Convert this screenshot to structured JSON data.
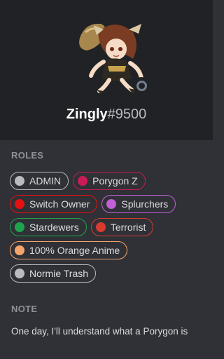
{
  "profile": {
    "username": "Zingly",
    "discriminator": "#9500",
    "status": "offline",
    "status_color": "#747f8d"
  },
  "roles_section": {
    "title": "ROLES",
    "items": [
      {
        "label": "ADMIN",
        "color": "#b9bbbe"
      },
      {
        "label": "Porygon Z",
        "color": "#c91b55"
      },
      {
        "label": "Switch Owner",
        "color": "#e61010"
      },
      {
        "label": "Splurchers",
        "color": "#c25fd6"
      },
      {
        "label": "Stardewers",
        "color": "#1ea54b"
      },
      {
        "label": "Terrorist",
        "color": "#d93a2e"
      },
      {
        "label": "100% Orange Anime",
        "color": "#f7a46a"
      },
      {
        "label": "Normie Trash",
        "color": "#b9bbbe"
      }
    ]
  },
  "note_section": {
    "title": "NOTE",
    "text": "One day, I'll understand what a Porygon is"
  },
  "colors": {
    "header_bg": "#202225",
    "panel_bg": "#2f3136"
  }
}
